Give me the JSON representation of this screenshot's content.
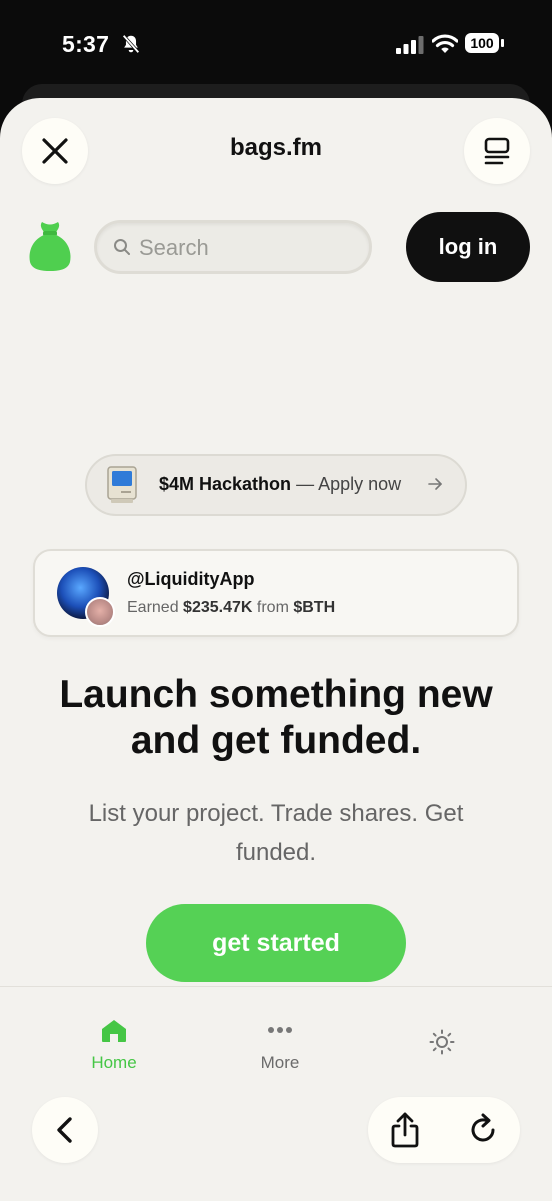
{
  "status_bar": {
    "time": "5:37",
    "battery": "100"
  },
  "browser": {
    "site_title": "bags.fm"
  },
  "header": {
    "search_placeholder": "Search",
    "login_label": "log in"
  },
  "hackathon": {
    "title": "$4M Hackathon",
    "separator": "—",
    "cta": "Apply now"
  },
  "earn_card": {
    "handle": "@LiquidityApp",
    "prefix": "Earned",
    "amount": "$235.47K",
    "middle": "from",
    "token": "$BTH"
  },
  "hero": {
    "headline_line1": "Launch something new",
    "headline_line2": "and get funded.",
    "subline": "List your project. Trade shares. Get funded.",
    "cta_label": "get started"
  },
  "bottom_nav": {
    "home_label": "Home",
    "more_label": "More"
  },
  "colors": {
    "accent_green": "#55d155",
    "page_background": "#f3f2ee",
    "dark_button": "#101010"
  },
  "icons": [
    "bell-slash-icon",
    "signal-icon",
    "wifi-icon",
    "battery-icon",
    "close-icon",
    "menu-icon",
    "bag-logo-icon",
    "search-icon",
    "macintosh-icon",
    "arrow-right-icon",
    "home-icon",
    "more-dots-icon",
    "sun-icon",
    "chevron-left-icon",
    "share-icon",
    "reload-icon"
  ]
}
